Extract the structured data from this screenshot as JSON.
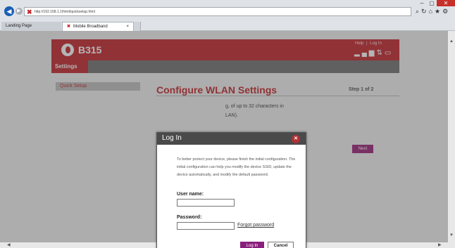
{
  "browser": {
    "url": "http://192.168.1.1/html/quicksetup.html",
    "win_min": "–",
    "win_max": "▢",
    "win_close": "✕",
    "tabs": [
      {
        "label": "Landing Page"
      },
      {
        "label": "Mobile Broadband"
      }
    ],
    "tab_close": "×"
  },
  "header": {
    "model": "B315",
    "help": "Help",
    "separator": "|",
    "login": "Log In"
  },
  "menu": {
    "settings": "Settings"
  },
  "sidebar": {
    "quick_setup": "Quick Setup"
  },
  "content": {
    "title": "Configure WLAN Settings",
    "step": "Step 1 of 2",
    "text_fragment_1": "g, of up to 32 characters in",
    "text_fragment_2": "LAN).",
    "next": "Next"
  },
  "dialog": {
    "title": "Log In",
    "message": "To better protect your device, please finish the initial configuration. The initial configuration can help you modify the device SSID, update the device automatically, and modify the default password.",
    "username_label": "User name:",
    "username_value": "",
    "password_label": "Password:",
    "password_value": "",
    "forgot_password": "Forgot password",
    "login_button": "Log In",
    "cancel_button": "Cancel"
  },
  "colors": {
    "brand_red": "#c62d32",
    "login_purple": "#8a1e7c",
    "next_purple": "#9e2a7e"
  }
}
